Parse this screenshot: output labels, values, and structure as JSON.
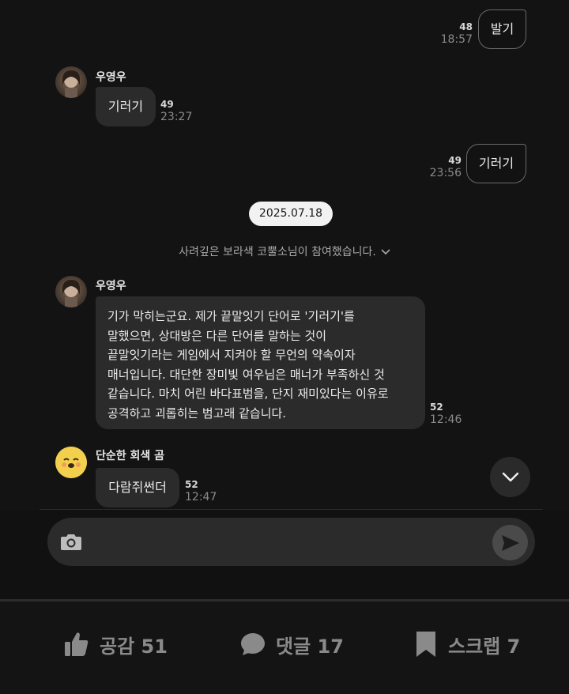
{
  "messages": [
    {
      "text": "발기",
      "count": "48",
      "time": "18:57"
    },
    {
      "sender": "우영우",
      "text": "기러기",
      "count": "49",
      "time": "23:27"
    },
    {
      "text": "기러기",
      "count": "49",
      "time": "23:56"
    },
    {
      "sender": "우영우",
      "lines": [
        "기가 막히는군요. 제가 끝말잇기 단어로 '기러기'를",
        "말했으면, 상대방은 다른 단어를 말하는 것이",
        "끝말잇기라는 게임에서 지켜야 할 무언의 약속이자",
        "매너입니다. 대단한 장미빛 여우님은 매너가 부족하신 것",
        "같습니다. 마치 어린 바다표범을, 단지 재미있다는 이유로",
        "공격하고 괴롭히는 범고래 같습니다."
      ],
      "count": "52",
      "time": "12:46"
    },
    {
      "sender": "단순한 회색 곰",
      "text": "다람쥐썬더",
      "count": "52",
      "time": "12:47"
    }
  ],
  "date_divider": "2025.07.18",
  "system_notice": "사려깊은 보라색 코뿔소님이 참여했습니다.",
  "input": {
    "placeholder": ""
  },
  "actions": {
    "like": "공감 51",
    "comment": "댓글 17",
    "scrap": "스크랩 7"
  }
}
